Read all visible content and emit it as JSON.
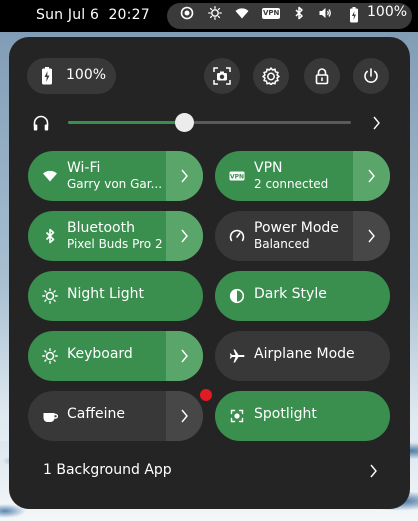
{
  "topbar": {
    "date": "Sun Jul 6",
    "time": "20:27",
    "battery_percent": "100%",
    "icons": [
      "screen-record-icon",
      "night-light-icon",
      "wifi-icon",
      "vpn-icon",
      "bluetooth-icon",
      "volume-icon",
      "battery-icon"
    ],
    "vpn_badge": "VPN"
  },
  "quick_settings": {
    "battery_label": "100%",
    "buttons": [
      "screenshot-icon",
      "settings-icon",
      "lock-icon",
      "power-icon"
    ],
    "volume": {
      "icon": "headphones-icon",
      "level": 0.41
    },
    "tiles": [
      {
        "title": "Wi-Fi",
        "subtitle": "Garry von Gar...",
        "active": true,
        "has_menu": true,
        "icon": "wifi-icon"
      },
      {
        "title": "VPN",
        "subtitle": "2 connected",
        "active": true,
        "has_menu": true,
        "icon": "vpn-icon"
      },
      {
        "title": "Bluetooth",
        "subtitle": "Pixel Buds Pro 2",
        "active": true,
        "has_menu": true,
        "icon": "bluetooth-icon"
      },
      {
        "title": "Power Mode",
        "subtitle": "Balanced",
        "active": false,
        "has_menu": true,
        "icon": "power-mode-icon"
      },
      {
        "title": "Night Light",
        "subtitle": "",
        "active": true,
        "has_menu": false,
        "icon": "night-light-icon"
      },
      {
        "title": "Dark Style",
        "subtitle": "",
        "active": true,
        "has_menu": false,
        "icon": "dark-style-icon"
      },
      {
        "title": "Keyboard",
        "subtitle": "",
        "active": true,
        "has_menu": true,
        "icon": "keyboard-brightness-icon"
      },
      {
        "title": "Airplane Mode",
        "subtitle": "",
        "active": false,
        "has_menu": false,
        "icon": "airplane-icon"
      },
      {
        "title": "Caffeine",
        "subtitle": "",
        "active": false,
        "has_menu": true,
        "icon": "coffee-icon"
      },
      {
        "title": "Spotlight",
        "subtitle": "",
        "active": true,
        "has_menu": false,
        "icon": "spotlight-icon"
      }
    ],
    "background_apps": "1 Background App"
  },
  "colors": {
    "accent": "#3a8f4f",
    "accent_light": "#5aa66a",
    "tile_off": "#383838",
    "panel": "#242424",
    "notification_dot": "#e01b24"
  }
}
